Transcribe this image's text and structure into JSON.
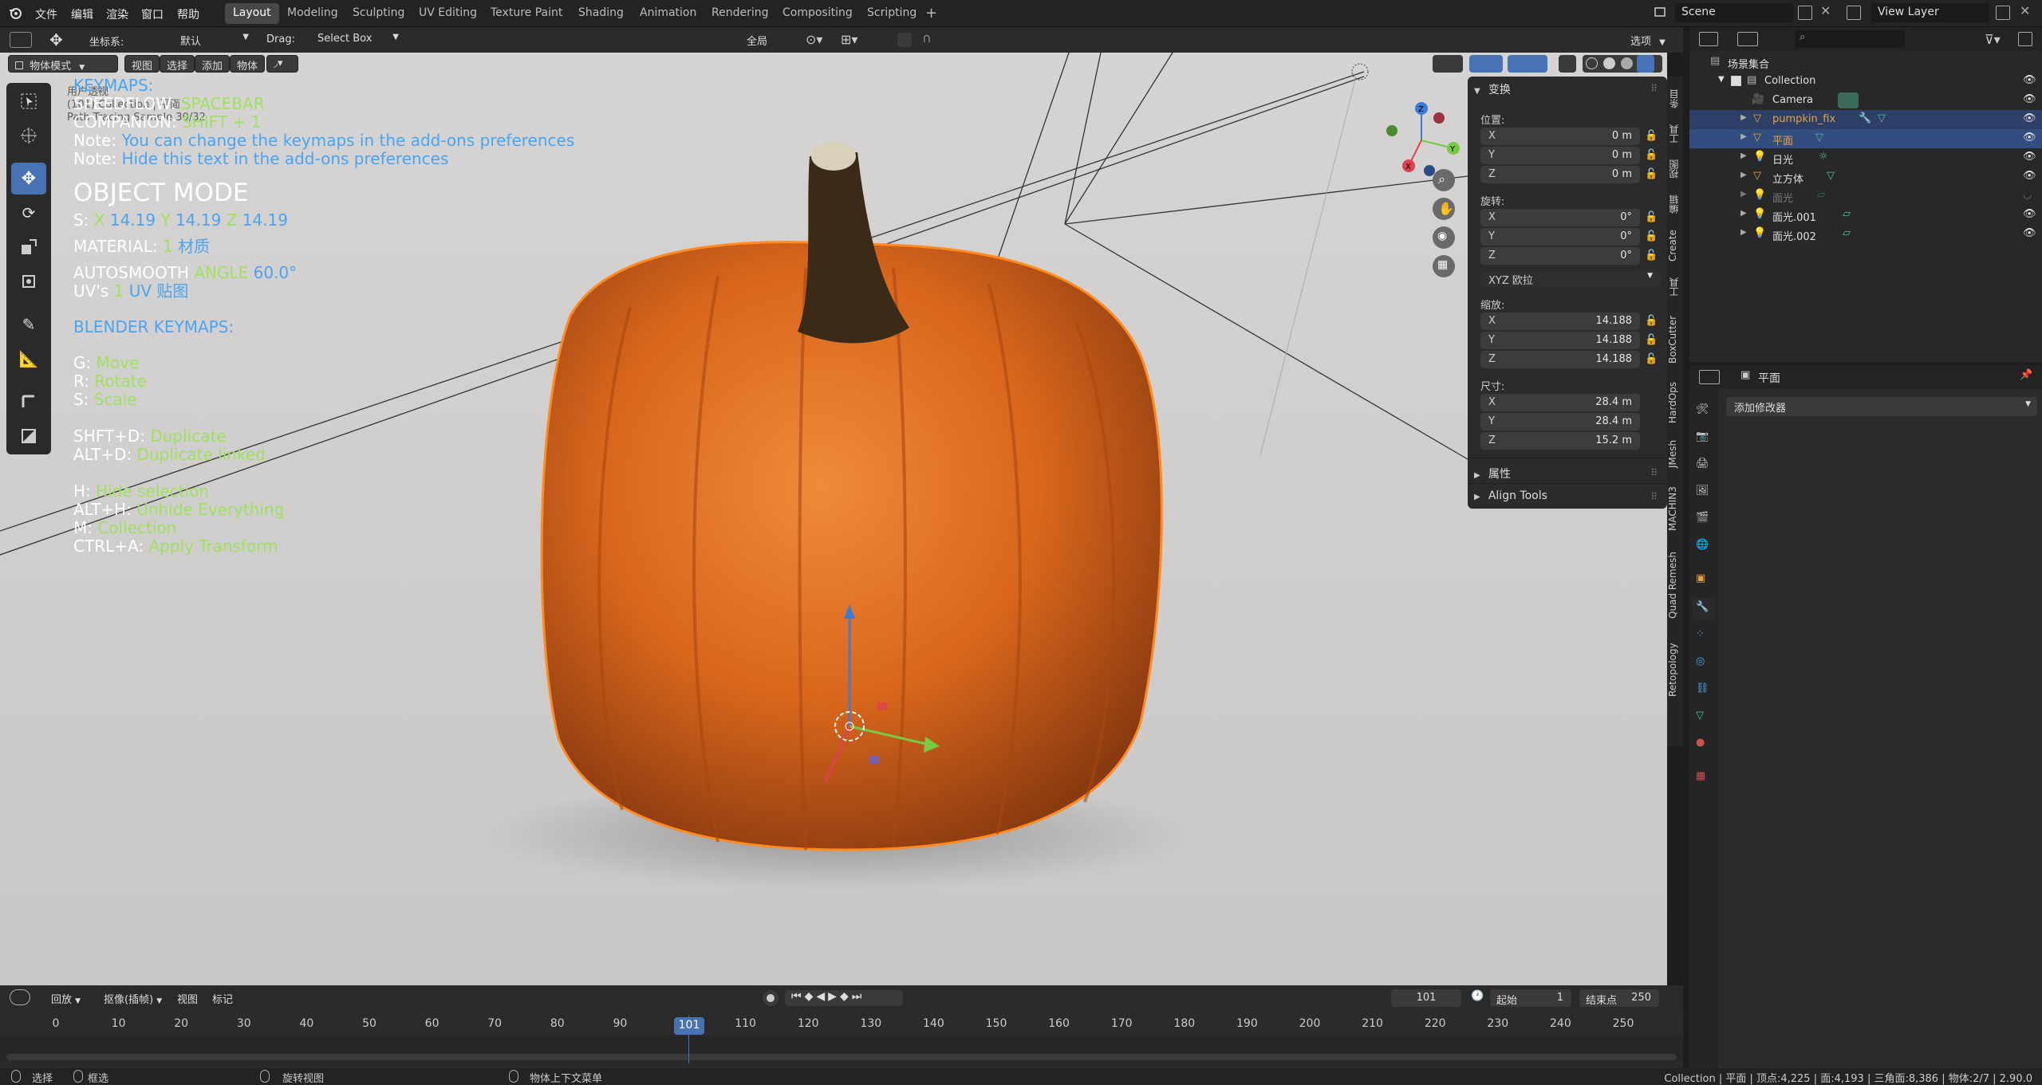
{
  "topmenu": {
    "items": [
      "文件",
      "编辑",
      "渲染",
      "窗口",
      "帮助"
    ],
    "workspaces": [
      "Layout",
      "Modeling",
      "Sculpting",
      "UV Editing",
      "Texture Paint",
      "Shading",
      "Animation",
      "Rendering",
      "Compositing",
      "Scripting"
    ],
    "active_workspace": "Layout",
    "scene": "Scene",
    "view_layer": "View Layer"
  },
  "header": {
    "coord_label": "坐标系:",
    "coord_value": "默认",
    "drag_label": "Drag:",
    "drag_value": "Select Box",
    "pivot_value": "全局",
    "options_label": "选项"
  },
  "viewport_header": {
    "mode": "物体模式",
    "menus": [
      "视图",
      "选择",
      "添加",
      "物体"
    ]
  },
  "overlay_info": {
    "view_name": "用户透视",
    "collection_line": "(101) Collection | 平面",
    "samples": "Path Tracing Sample 30/32"
  },
  "hud": {
    "keymaps_title": "KEYMAPS:",
    "speedflow_label": "SPEEDFLOW:",
    "speedflow_val": "SPACEBAR",
    "companion_label": "COMPANION:",
    "companion_val": "SHIFT + 1",
    "note1_label": "Note:",
    "note1_text": "You can change the keymaps in the add-ons preferences",
    "note2_label": "Note:",
    "note2_text": "Hide this text in the add-ons preferences",
    "mode_title": "OBJECT MODE",
    "scale_label": "S:",
    "scale_x_axis": "X",
    "scale_x": "14.19",
    "scale_y_axis": "Y",
    "scale_y": "14.19",
    "scale_z_axis": "Z",
    "scale_z": "14.19",
    "material_label": "MATERIAL:",
    "material_count": "1",
    "material_name": "材质",
    "autosmooth_label": "AUTOSMOOTH",
    "autosmooth_angle_label": "ANGLE",
    "autosmooth_val": "60.0°",
    "uvs_label": "UV's",
    "uvs_count": "1",
    "uvs_name": "UV 贴图",
    "blender_keymaps_title": "BLENDER KEYMAPS:",
    "keys": [
      {
        "key": "G:",
        "action": "Move"
      },
      {
        "key": "R:",
        "action": "Rotate"
      },
      {
        "key": "S:",
        "action": "Scale"
      },
      {
        "key": "SHFT+D:",
        "action": "Duplicate"
      },
      {
        "key": "ALT+D:",
        "action": "Duplicate linked"
      },
      {
        "key": "H:",
        "action": "Hide selection"
      },
      {
        "key": "ALT+H:",
        "action": "Unhide Everything"
      },
      {
        "key": "M:",
        "action": "Collection"
      },
      {
        "key": "CTRL+A:",
        "action": "Apply Transform"
      }
    ]
  },
  "npanel": {
    "transform_title": "变换",
    "location_label": "位置:",
    "location": [
      {
        "axis": "X",
        "value": "0 m"
      },
      {
        "axis": "Y",
        "value": "0 m"
      },
      {
        "axis": "Z",
        "value": "0 m"
      }
    ],
    "rotation_label": "旋转:",
    "rotation": [
      {
        "axis": "X",
        "value": "0°"
      },
      {
        "axis": "Y",
        "value": "0°"
      },
      {
        "axis": "Z",
        "value": "0°"
      }
    ],
    "rotation_mode": "XYZ 欧拉",
    "scale_label": "缩放:",
    "scale": [
      {
        "axis": "X",
        "value": "14.188"
      },
      {
        "axis": "Y",
        "value": "14.188"
      },
      {
        "axis": "Z",
        "value": "14.188"
      }
    ],
    "dimensions_label": "尺寸:",
    "dimensions": [
      {
        "axis": "X",
        "value": "28.4 m"
      },
      {
        "axis": "Y",
        "value": "28.4 m"
      },
      {
        "axis": "Z",
        "value": "15.2 m"
      }
    ],
    "properties_title": "属性",
    "align_tools_title": "Align Tools"
  },
  "sidetabs": [
    "条目",
    "工具",
    "视图",
    "编辑",
    "Create",
    "工具",
    "BoxCutter",
    "HardOps",
    "JMesh",
    "MACHIN3",
    "Quad Remesh",
    "Retopology"
  ],
  "outliner": {
    "root": "场景集合",
    "collection": "Collection",
    "items": [
      {
        "name": "Camera",
        "color": "#e0e0e0"
      },
      {
        "name": "pumpkin_fix",
        "color": "#e8a040"
      },
      {
        "name": "平面",
        "color": "#e8a040"
      },
      {
        "name": "日光",
        "color": "#e0e0e0"
      },
      {
        "name": "立方体",
        "color": "#e0e0e0"
      },
      {
        "name": "面光",
        "color": "#7a7a7a"
      },
      {
        "name": "面光.001",
        "color": "#e0e0e0"
      },
      {
        "name": "面光.002",
        "color": "#e0e0e0"
      }
    ]
  },
  "properties": {
    "object_name": "平面",
    "add_modifier": "添加修改器"
  },
  "timeline": {
    "menus": [
      "回放",
      "抠像(插帧)",
      "视图",
      "标记"
    ],
    "current_frame": "101",
    "start_label": "起始",
    "start": "1",
    "end_label": "结束点",
    "end": "250",
    "ticks": [
      "0",
      "10",
      "20",
      "30",
      "40",
      "50",
      "60",
      "70",
      "80",
      "90",
      "101",
      "110",
      "120",
      "130",
      "140",
      "150",
      "160",
      "170",
      "180",
      "190",
      "200",
      "210",
      "220",
      "230",
      "240",
      "250"
    ]
  },
  "statusbar": {
    "select": "选择",
    "box_select": "框选",
    "rotate_view": "旋转视图",
    "context_menu": "物体上下文菜单",
    "stats": "Collection | 平面 | 顶点:4,225 | 面:4,193 | 三角面:8,386 | 物体:2/7 | 2.90.0"
  },
  "colors": {
    "accent": "#4772b3",
    "hud_blue": "#4aa4f0",
    "hud_green": "#9fe060",
    "selected_outline": "#ff8a1f"
  }
}
